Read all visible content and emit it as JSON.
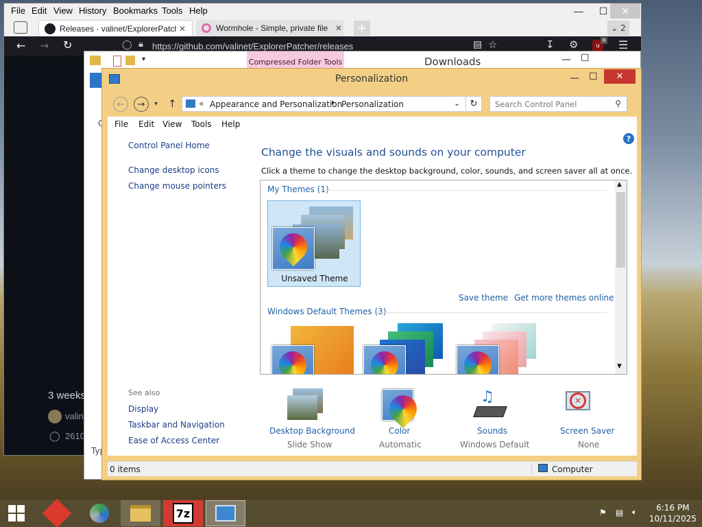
{
  "firefox": {
    "menu": [
      "File",
      "Edit",
      "View",
      "History",
      "Bookmarks",
      "Tools",
      "Help"
    ],
    "tabs": [
      {
        "label": "Releases · valinet/ExplorerPatcher"
      },
      {
        "label": "Wormhole - Simple, private file"
      }
    ],
    "tab_count": "2",
    "url": "https://github.com/valinet/ExplorerPatcher/releases",
    "ublock_badge": "8",
    "page": {
      "time_ago": "3 weeks",
      "author": "valin",
      "tag_text": "2610",
      "extra": "7"
    }
  },
  "explorer": {
    "context_tab": "Compressed Folder Tools",
    "title": "Downloads",
    "type_fragment": "Typ",
    "c_fragment": "C"
  },
  "personalization": {
    "title": "Personalization",
    "breadcrumb": {
      "prefix": "«",
      "items": [
        "Appearance and Personalization",
        "Personalization"
      ]
    },
    "search_placeholder": "Search Control Panel",
    "menu": [
      "File",
      "Edit",
      "View",
      "Tools",
      "Help"
    ],
    "sidebar": {
      "home": "Control Panel Home",
      "links": [
        "Change desktop icons",
        "Change mouse pointers"
      ],
      "see_also_label": "See also",
      "see_also": [
        "Display",
        "Taskbar and Navigation",
        "Ease of Access Center"
      ]
    },
    "heading": "Change the visuals and sounds on your computer",
    "subheading": "Click a theme to change the desktop background, color, sounds, and screen saver all at once.",
    "my_themes": {
      "label": "My Themes (1)",
      "items": [
        "Unsaved Theme"
      ]
    },
    "actions": {
      "save": "Save theme",
      "more": "Get more themes online"
    },
    "default_themes": {
      "label": "Windows Default Themes (3)"
    },
    "bottom": [
      {
        "title": "Desktop Background",
        "value": "Slide Show",
        "icon": "desktop-background-icon"
      },
      {
        "title": "Color",
        "value": "Automatic",
        "icon": "color-icon"
      },
      {
        "title": "Sounds",
        "value": "Windows Default",
        "icon": "sounds-icon"
      },
      {
        "title": "Screen Saver",
        "value": "None",
        "icon": "screen-saver-icon"
      }
    ],
    "status": {
      "items": "0 items",
      "location": "Computer"
    }
  },
  "taskbar": {
    "apps": [
      "start",
      "wps-office",
      "chrome-like",
      "file-explorer",
      "7zip",
      "control-panel"
    ],
    "time": "6:16 PM",
    "date": "10/11/2025"
  }
}
